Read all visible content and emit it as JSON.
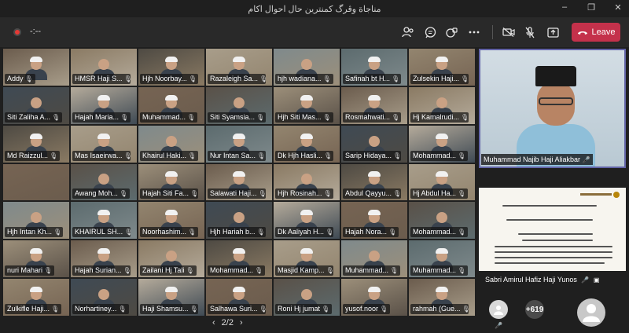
{
  "window": {
    "title": "مناجاة وڤرگ كمنترين حال احوال اكام",
    "controls": [
      "–",
      "❐",
      "✕"
    ]
  },
  "toolbar": {
    "timer": "-:--",
    "leave_label": "Leave",
    "icons": [
      "participants-icon",
      "chat-icon",
      "reactions-icon",
      "more-icon",
      "camera-off-icon",
      "mic-off-icon",
      "share-icon"
    ],
    "leave_color": "#c4314b",
    "accent": "#6264a7"
  },
  "grid": {
    "tiles": [
      {
        "name": "Addy"
      },
      {
        "name": "HMSR Haji S..."
      },
      {
        "name": "Hjh Noorbay..."
      },
      {
        "name": "Razaleigh Sa..."
      },
      {
        "name": "hjh wadiana..."
      },
      {
        "name": "Safinah bt H..."
      },
      {
        "name": "Zulsekin Haji..."
      },
      {
        "name": "Siti Zaliha A..."
      },
      {
        "name": "Hajah Maria..."
      },
      {
        "name": "Muhammad..."
      },
      {
        "name": "Siti Syamsia..."
      },
      {
        "name": "Hjh Siti Mas..."
      },
      {
        "name": "Rosmahwati..."
      },
      {
        "name": "Hj Kamalrudi..."
      },
      {
        "name": "Md Raizzul..."
      },
      {
        "name": "Mas Isaeirwa..."
      },
      {
        "name": "Khairul Haki..."
      },
      {
        "name": "Nur Intan Sa..."
      },
      {
        "name": "Dk Hjh Hasli..."
      },
      {
        "name": "Sarip Hidaya..."
      },
      {
        "name": "Mohammad..."
      },
      {
        "name": ""
      },
      {
        "name": "Awang Moh..."
      },
      {
        "name": "Hajah Siti Fa..."
      },
      {
        "name": "Salawati Haji..."
      },
      {
        "name": "Hjh Rosinah..."
      },
      {
        "name": "Abdul Qayyu..."
      },
      {
        "name": "Hj Abdul Ha..."
      },
      {
        "name": "Hjh Intan Kh..."
      },
      {
        "name": "KHAIRUL SH..."
      },
      {
        "name": "Noorhashim..."
      },
      {
        "name": "Hjh Hariah b..."
      },
      {
        "name": "Dk Aaliyah H..."
      },
      {
        "name": "Hajah Nora..."
      },
      {
        "name": "Mohammad..."
      },
      {
        "name": "nuri Mahari"
      },
      {
        "name": "Hajah Surian..."
      },
      {
        "name": "Zailani Hj Tali"
      },
      {
        "name": "Mohammad..."
      },
      {
        "name": "Masjid Kamp..."
      },
      {
        "name": "Muhammad..."
      },
      {
        "name": "Muhammad..."
      },
      {
        "name": "Zulkifle Haji..."
      },
      {
        "name": "Norhartiney..."
      },
      {
        "name": "Haji Shamsu..."
      },
      {
        "name": "Salhawa Suri..."
      },
      {
        "name": "Roni Hj jumat"
      },
      {
        "name": "yusof.noor"
      },
      {
        "name": "rahmah (Gue..."
      }
    ],
    "pager_label": "2/2"
  },
  "featured": {
    "name": "Muhammad Najib Haji Aliakbar"
  },
  "shared": {
    "name": "Sabri Amirul Hafiz Haji Yunos"
  },
  "overflow": {
    "count": "+619"
  }
}
